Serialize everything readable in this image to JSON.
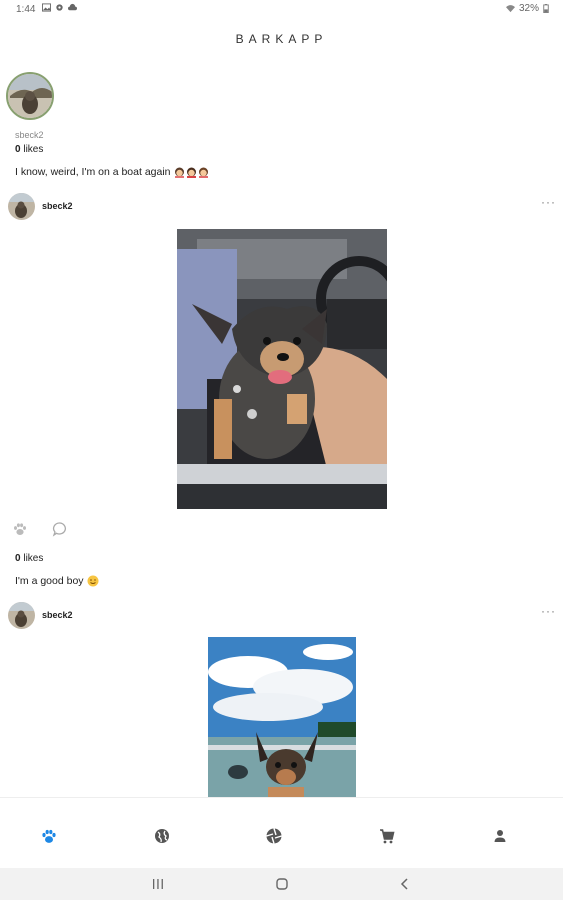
{
  "status_bar": {
    "time": "1:44",
    "battery": "32%"
  },
  "app": {
    "title": "BARKAPP"
  },
  "profile": {
    "username": "sbeck2"
  },
  "top_post": {
    "likes_count": "0",
    "likes_label": "likes",
    "caption": "I know, weird, I'm on a boat again"
  },
  "post1": {
    "username": "sbeck2",
    "more": "···",
    "likes_count": "0",
    "likes_label": "likes",
    "caption": "I'm a good boy"
  },
  "post2": {
    "username": "sbeck2",
    "more": "···"
  },
  "icons": {
    "post_actions": [
      "paw-icon",
      "comment-icon"
    ],
    "bottom_nav": [
      "paw-icon",
      "globe-icon",
      "camera-aperture-icon",
      "cart-icon",
      "person-icon"
    ],
    "system_nav": [
      "recents-icon",
      "home-icon",
      "back-icon"
    ]
  },
  "colors": {
    "accent": "#1e88e5",
    "nav_inactive": "#555555"
  }
}
